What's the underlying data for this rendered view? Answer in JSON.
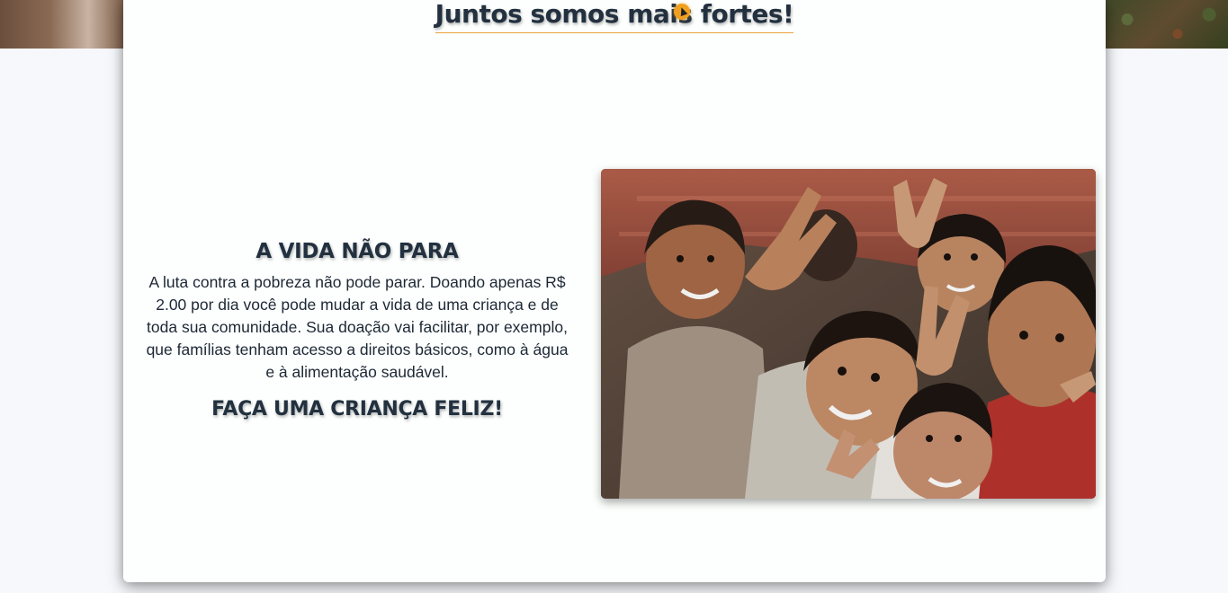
{
  "header": {
    "headline": "Juntos somos mais fortes!"
  },
  "section": {
    "title": "A VIDA NÃO PARA",
    "body": "A luta contra a pobreza não pode parar. Doando apenas R$ 2.00 por dia você pode mudar a vida de uma criança e de toda sua comunidade. Sua doação vai facilitar, por exemplo, que famílias tenham acesso a direitos básicos, como à água e à alimentação saudável.",
    "cta": "FAÇA UMA CRIANÇA FELIZ!"
  },
  "colors": {
    "headline_text": "#22303f",
    "underline_accent": "#e8a33a",
    "page_background": "#f6f8fc",
    "card_background": "#fdfffe"
  },
  "icons": {
    "cursor": "pointer-icon"
  }
}
